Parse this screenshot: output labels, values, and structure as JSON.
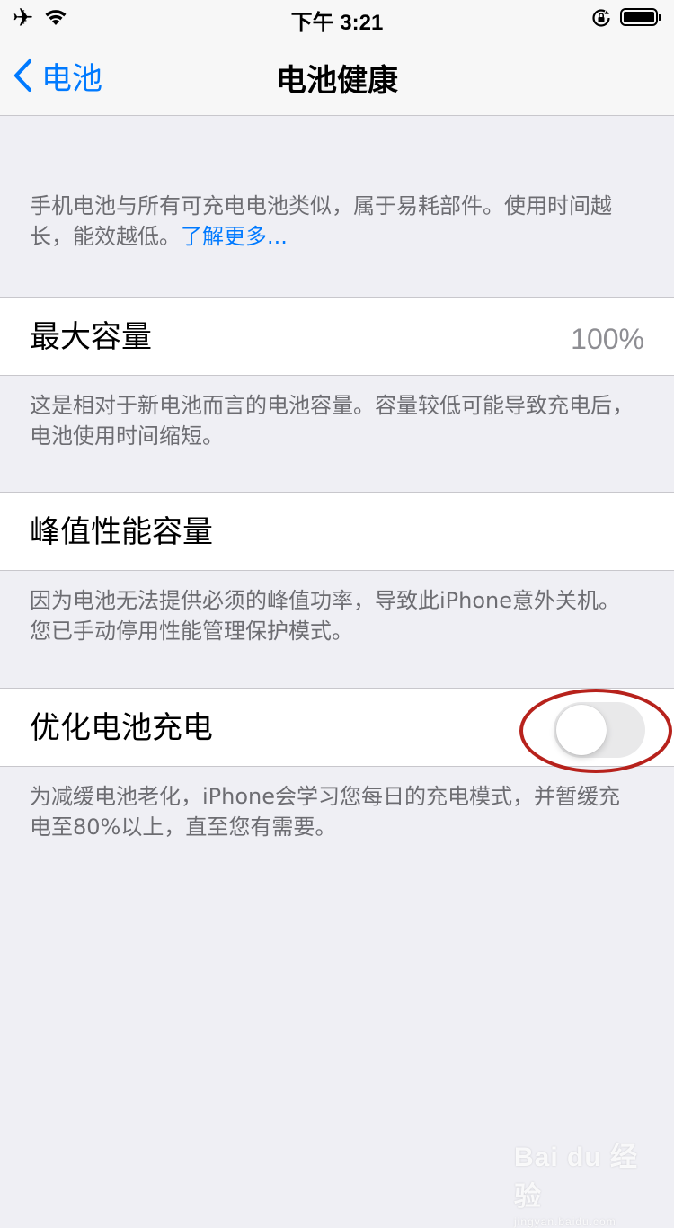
{
  "status_bar": {
    "time": "下午 3:21",
    "icons": [
      "airplane-icon",
      "wifi-icon",
      "orientation-lock-icon",
      "battery-icon"
    ],
    "battery_level": 1.0
  },
  "nav": {
    "back_label": "电池",
    "title": "电池健康"
  },
  "intro": {
    "text": "手机电池与所有可充电电池类似，属于易耗部件。使用时间越长，能效越低。",
    "link": "了解更多..."
  },
  "max_capacity": {
    "label": "最大容量",
    "value": "100%",
    "footnote": "这是相对于新电池而言的电池容量。容量较低可能导致充电后，电池使用时间缩短。"
  },
  "peak_performance": {
    "label": "峰值性能容量",
    "footnote": "因为电池无法提供必须的峰值功率，导致此iPhone意外关机。您已手动停用性能管理保护模式。"
  },
  "optimized_charging": {
    "label": "优化电池充电",
    "enabled": false,
    "footnote": "为减缓电池老化，iPhone会学习您每日的充电模式，并暂缓充电至80%以上，直至您有需要。"
  },
  "watermark": {
    "main": "Bai du 经验",
    "sub": "jingyan.baidu.com"
  },
  "colors": {
    "accent": "#007aff",
    "background": "#efeff4",
    "annotation": "#b7221c"
  }
}
